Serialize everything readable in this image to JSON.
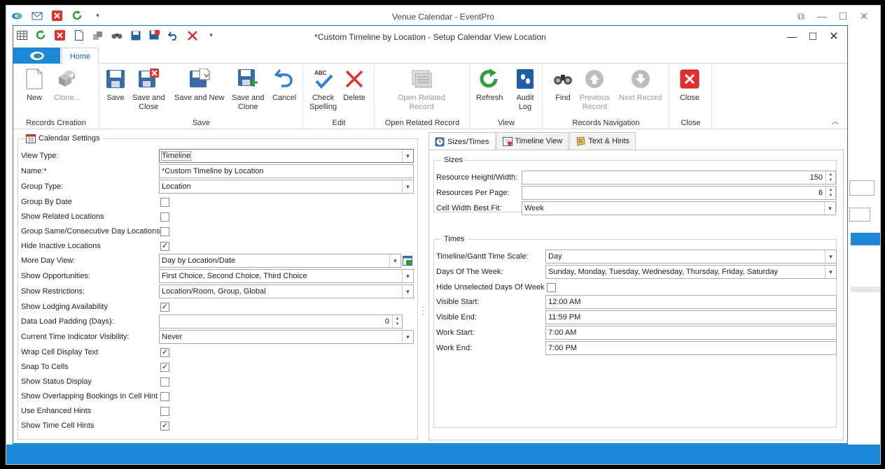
{
  "background_window": {
    "title": "Venue Calendar - EventPro"
  },
  "dialog": {
    "title": "*Custom Timeline by Location - Setup Calendar View Location",
    "ribbon_tab": "Home"
  },
  "ribbon": {
    "groups": {
      "records_creation": "Records Creation",
      "save": "Save",
      "edit": "Edit",
      "open_related_record": "Open Related Record",
      "view": "View",
      "records_navigation": "Records Navigation",
      "close": "Close"
    },
    "buttons": {
      "new": "New",
      "clone": "Clone...",
      "save": "Save",
      "save_and_close_1": "Save and",
      "save_and_close_2": "Close",
      "save_and_new": "Save and New",
      "save_and_clone_1": "Save and",
      "save_and_clone_2": "Clone",
      "cancel": "Cancel",
      "check_spelling_1": "Check",
      "check_spelling_2": "Spelling",
      "delete": "Delete",
      "open_related_1": "Open Related",
      "open_related_2": "Record",
      "refresh": "Refresh",
      "audit_log_1": "Audit",
      "audit_log_2": "Log",
      "find": "Find",
      "previous_record_1": "Previous",
      "previous_record_2": "Record",
      "next_record": "Next Record",
      "close": "Close"
    }
  },
  "calendar_settings": {
    "heading": "Calendar Settings",
    "view_type": {
      "label": "View Type:",
      "value": "Timeline"
    },
    "name": {
      "label": "Name:*",
      "value": "*Custom Timeline by Location"
    },
    "group_type": {
      "label": "Group Type:",
      "value": "Location"
    },
    "group_by_date": {
      "label": "Group By Date",
      "checked": false
    },
    "show_related_locations": {
      "label": "Show Related Locations",
      "checked": false
    },
    "group_same_day": {
      "label": "Group Same/Consecutive Day Locations",
      "checked": false
    },
    "hide_inactive_locations": {
      "label": "Hide Inactive Locations",
      "checked": true
    },
    "more_day_view": {
      "label": "More Day View:",
      "value": "Day by Location/Date"
    },
    "show_opportunities": {
      "label": "Show Opportunities:",
      "value": "First Choice, Second Choice, Third Choice"
    },
    "show_restrictions": {
      "label": "Show Restrictions:",
      "value": "Location/Room, Group, Global"
    },
    "show_lodging_availability": {
      "label": "Show Lodging Availability",
      "checked": true
    },
    "data_load_padding": {
      "label": "Data Load Padding (Days):",
      "value": "0"
    },
    "current_time_indicator": {
      "label": "Current Time Indicator Visibility:",
      "value": "Never"
    },
    "wrap_cell_display_text": {
      "label": "Wrap Cell Display Text",
      "checked": true
    },
    "snap_to_cells": {
      "label": "Snap To Cells",
      "checked": true
    },
    "show_status_display": {
      "label": "Show Status Display",
      "checked": false
    },
    "show_overlapping": {
      "label": "Show Overlapping Bookings In Cell Hint",
      "checked": false
    },
    "use_enhanced_hints": {
      "label": "Use Enhanced Hints",
      "checked": false
    },
    "show_time_cell_hints": {
      "label": "Show Time Cell Hints",
      "checked": true
    }
  },
  "tabs": {
    "sizes_times": "Sizes/Times",
    "timeline_view": "Timeline View",
    "text_hints": "Text & Hints"
  },
  "sizes": {
    "heading": "Sizes",
    "resource_height_width": {
      "label": "Resource Height/Width:",
      "value": "150"
    },
    "resources_per_page": {
      "label": "Resources Per Page:",
      "value": "6"
    },
    "cell_width_best_fit": {
      "label": "Cell Width Best Fit:",
      "value": "Week"
    }
  },
  "times": {
    "heading": "Times",
    "time_scale": {
      "label": "Timeline/Gantt Time Scale:",
      "value": "Day"
    },
    "days_of_week": {
      "label": "Days Of The Week:",
      "value": "Sunday, Monday, Tuesday, Wednesday, Thursday, Friday, Saturday"
    },
    "hide_unselected_days": {
      "label": "Hide Unselected Days Of Week",
      "checked": false
    },
    "visible_start": {
      "label": "Visible Start:",
      "value": "12:00 AM"
    },
    "visible_end": {
      "label": "Visible End:",
      "value": "11:59 PM"
    },
    "work_start": {
      "label": "Work Start:",
      "value": "7:00 AM"
    },
    "work_end": {
      "label": "Work End:",
      "value": "7:00 PM"
    }
  },
  "colors": {
    "accent_blue": "#1e88d8",
    "close_red": "#e03131",
    "refresh_green": "#2e9e3a"
  }
}
